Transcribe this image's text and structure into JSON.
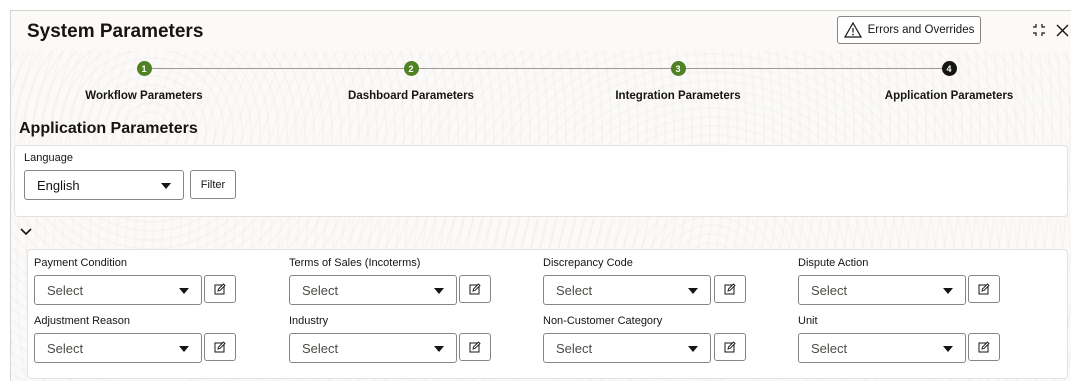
{
  "header": {
    "title": "System Parameters",
    "errors_button_label": "Errors and Overrides"
  },
  "icons": {
    "warning": "warning-triangle-icon",
    "collapse": "collapse-icon",
    "close": "close-icon",
    "chevron": "chevron-down-icon",
    "edit": "edit-icon",
    "caret": "caret-down-icon"
  },
  "train": {
    "steps": [
      {
        "number": "1",
        "label": "Workflow Parameters",
        "state": "done"
      },
      {
        "number": "2",
        "label": "Dashboard Parameters",
        "state": "done"
      },
      {
        "number": "3",
        "label": "Integration Parameters",
        "state": "done"
      },
      {
        "number": "4",
        "label": "Application Parameters",
        "state": "current"
      }
    ]
  },
  "section_title": "Application Parameters",
  "language": {
    "label": "Language",
    "value": "English",
    "filter_label": "Filter"
  },
  "fields": [
    {
      "label": "Payment Condition",
      "value": "Select"
    },
    {
      "label": "Terms of Sales (Incoterms)",
      "value": "Select"
    },
    {
      "label": "Discrepancy Code",
      "value": "Select"
    },
    {
      "label": "Dispute Action",
      "value": "Select"
    },
    {
      "label": "Adjustment Reason",
      "value": "Select"
    },
    {
      "label": "Industry",
      "value": "Select"
    },
    {
      "label": "Non-Customer Category",
      "value": "Select"
    },
    {
      "label": "Unit",
      "value": "Select"
    }
  ],
  "colors": {
    "step_done": "#508223",
    "step_current": "#161513",
    "border": "#8a8580",
    "background": "#fbfaf9"
  }
}
